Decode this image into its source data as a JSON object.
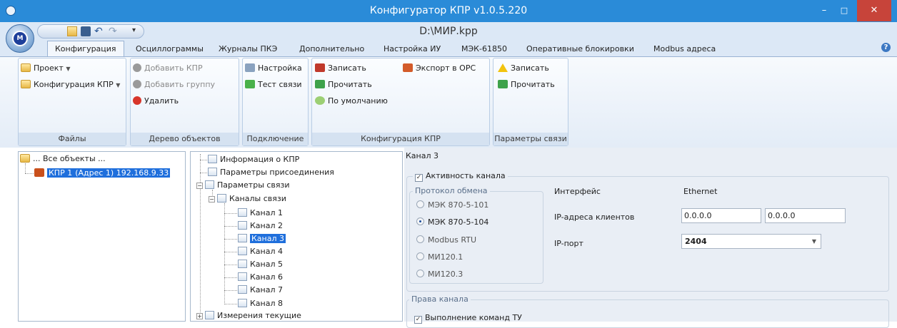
{
  "window": {
    "title": "Конфигуратор КПР v1.0.5.220",
    "file_path": "D:\\МИР.kpp",
    "controls": [
      "–",
      "□",
      "✕"
    ]
  },
  "tabs": [
    {
      "label": "Конфигурация",
      "active": true
    },
    {
      "label": "Осциллограммы"
    },
    {
      "label": "Журналы ПКЭ"
    },
    {
      "label": "Дополнительно"
    },
    {
      "label": "Настройка ИУ"
    },
    {
      "label": "МЭК-61850"
    },
    {
      "label": "Оперативные блокировки"
    },
    {
      "label": "Modbus адреса"
    }
  ],
  "help_glyph": "?",
  "ribbon": {
    "files": {
      "label": "Файлы",
      "project": "Проект",
      "config": "Конфигурация КПР"
    },
    "tree": {
      "label": "Дерево объектов",
      "add_kpr": "Добавить КПР",
      "add_group": "Добавить группу",
      "delete": "Удалить"
    },
    "connection": {
      "label": "Подключение",
      "setup": "Настройка",
      "test": "Тест связи"
    },
    "config": {
      "label": "Конфигурация КПР",
      "write": "Записать",
      "read": "Прочитать",
      "default": "По умолчанию",
      "export": "Экспорт в OPC"
    },
    "comm": {
      "label": "Параметры связи",
      "write": "Записать",
      "read": "Прочитать"
    }
  },
  "object_tree": {
    "root": "... Все объекты ...",
    "kpr_name": "КПР 1",
    "kpr_addr": "(Адрес 1) 192.168.9.33"
  },
  "param_tree": {
    "info": "Информация о КПР",
    "connect_params": "Параметры присоединения",
    "comm_params": "Параметры связи",
    "channels": "Каналы связи",
    "channel_list": [
      "Канал 1",
      "Канал 2",
      "Канал 3",
      "Канал 4",
      "Канал 5",
      "Канал 6",
      "Канал 7",
      "Канал 8"
    ],
    "selected_channel": "Канал 3",
    "measurements": "Измерения текущие"
  },
  "details": {
    "heading": "Канал 3",
    "active_label": "Активность канала",
    "active_checked": true,
    "protocol_legend": "Протокол обмена",
    "protocols": [
      "МЭК 870-5-101",
      "МЭК 870-5-104",
      "Modbus RTU",
      "МИ120.1",
      "МИ120.3"
    ],
    "selected_protocol": "МЭК 870-5-104",
    "interface_label": "Интерфейс",
    "interface_value": "Ethernet",
    "clients_label": "IP-адреса клиентов",
    "client_ip_1": "0.0.0.0",
    "client_ip_2": "0.0.0.0",
    "port_label": "IP-порт",
    "port_value": "2404",
    "rights_legend": "Права канала",
    "tu_label": "Выполнение команд ТУ",
    "tu_checked": true
  },
  "colors": {
    "titlebar": "#2a8bd8",
    "close_button": "#c7443a",
    "selection": "#1f6fdc",
    "ribbon_bg": "#dce8f6"
  }
}
